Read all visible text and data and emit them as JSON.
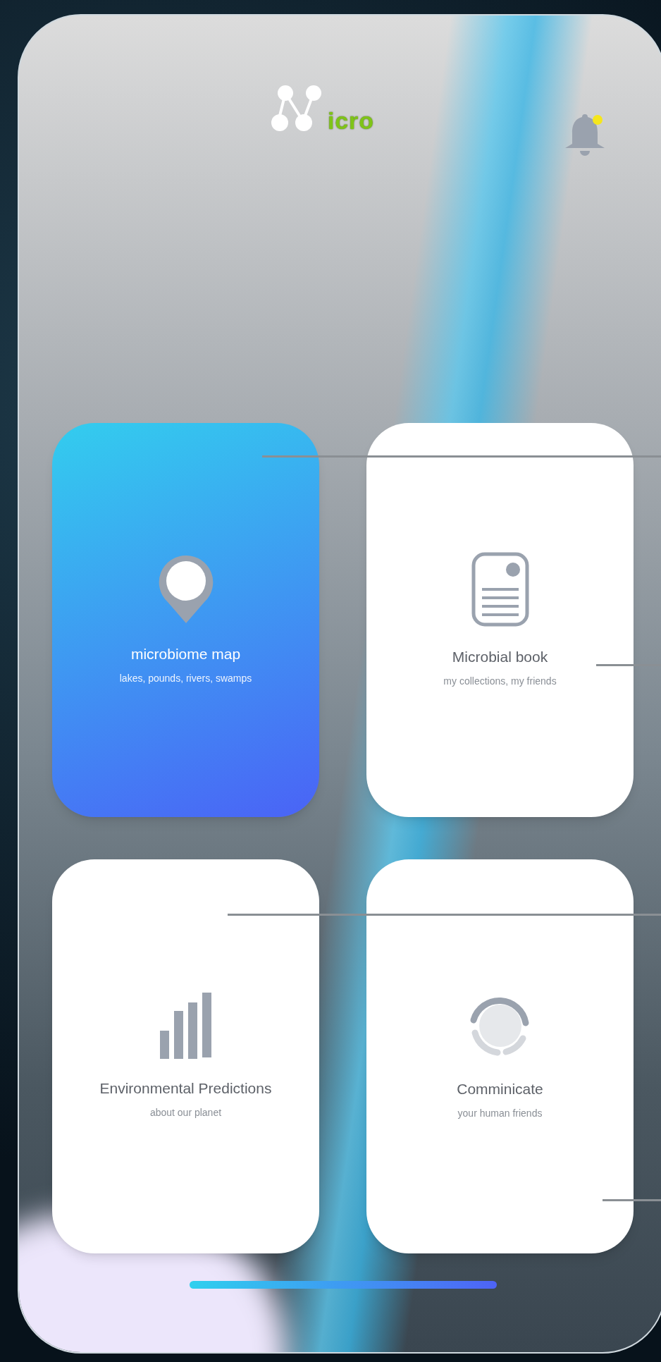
{
  "header": {
    "logo_text": "icro",
    "notification": {
      "unread": true
    }
  },
  "cards": [
    {
      "kind": "map",
      "title": "microbiome map",
      "subtitle": "lakes, pounds, rivers, swamps",
      "selected": true
    },
    {
      "kind": "book",
      "title": "Microbial book",
      "subtitle": "my collections, my friends",
      "selected": false
    },
    {
      "kind": "chart",
      "title": "Environmental Predictions",
      "subtitle": "about our planet",
      "selected": false
    },
    {
      "kind": "ring",
      "title": "Comminicate",
      "subtitle": "your human friends",
      "selected": false
    }
  ]
}
